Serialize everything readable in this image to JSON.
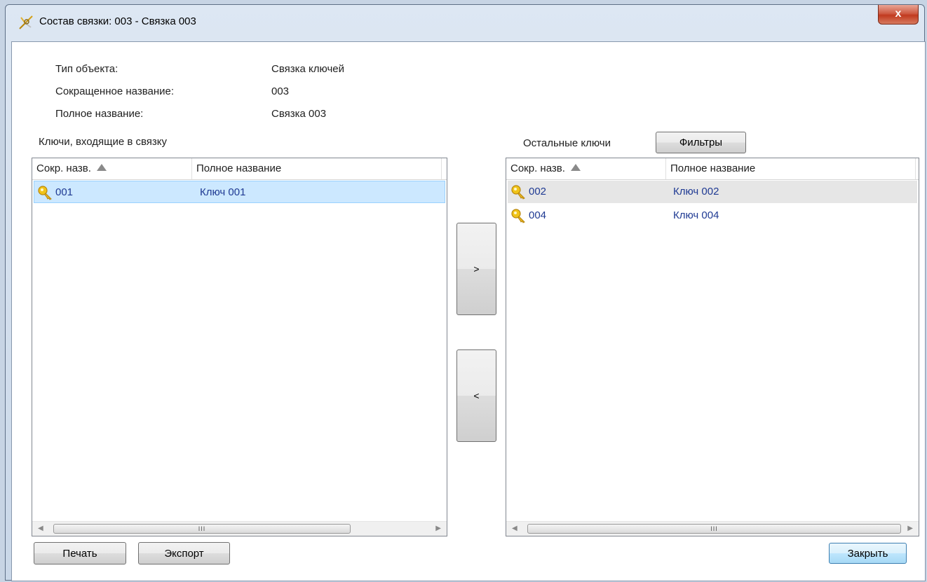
{
  "window": {
    "title": "Состав связки: 003 - Связка 003",
    "close_label": "x"
  },
  "info": {
    "type_label": "Тип объекта:",
    "type_value": "Связка ключей",
    "short_label": "Сокращенное название:",
    "short_value": "003",
    "full_label": "Полное название:",
    "full_value": "Связка 003"
  },
  "left_panel": {
    "title": "Ключи, входящие в связку",
    "columns": [
      "Сокр. назв.",
      "Полное название"
    ],
    "rows": [
      {
        "code": "001",
        "name": "Ключ 001",
        "icon": "key-icon",
        "selected": true
      }
    ]
  },
  "right_panel": {
    "title": "Остальные ключи",
    "filters_label": "Фильтры",
    "columns": [
      "Сокр. назв.",
      "Полное название"
    ],
    "rows": [
      {
        "code": "002",
        "name": "Ключ 002",
        "icon": "key-icon",
        "hover": true
      },
      {
        "code": "004",
        "name": "Ключ 004",
        "icon": "key-icon"
      }
    ]
  },
  "transfer": {
    "add_label": ">",
    "remove_label": "<"
  },
  "footer": {
    "print_label": "Печать",
    "export_label": "Экспорт",
    "close_label": "Закрыть"
  },
  "scrollbar": {
    "thumb_grip": "III"
  },
  "colors": {
    "selected_row": "#cce8ff",
    "hover_row": "#e6e6e6",
    "link_text": "#1f3a93",
    "close_button": "#c13a1f"
  }
}
